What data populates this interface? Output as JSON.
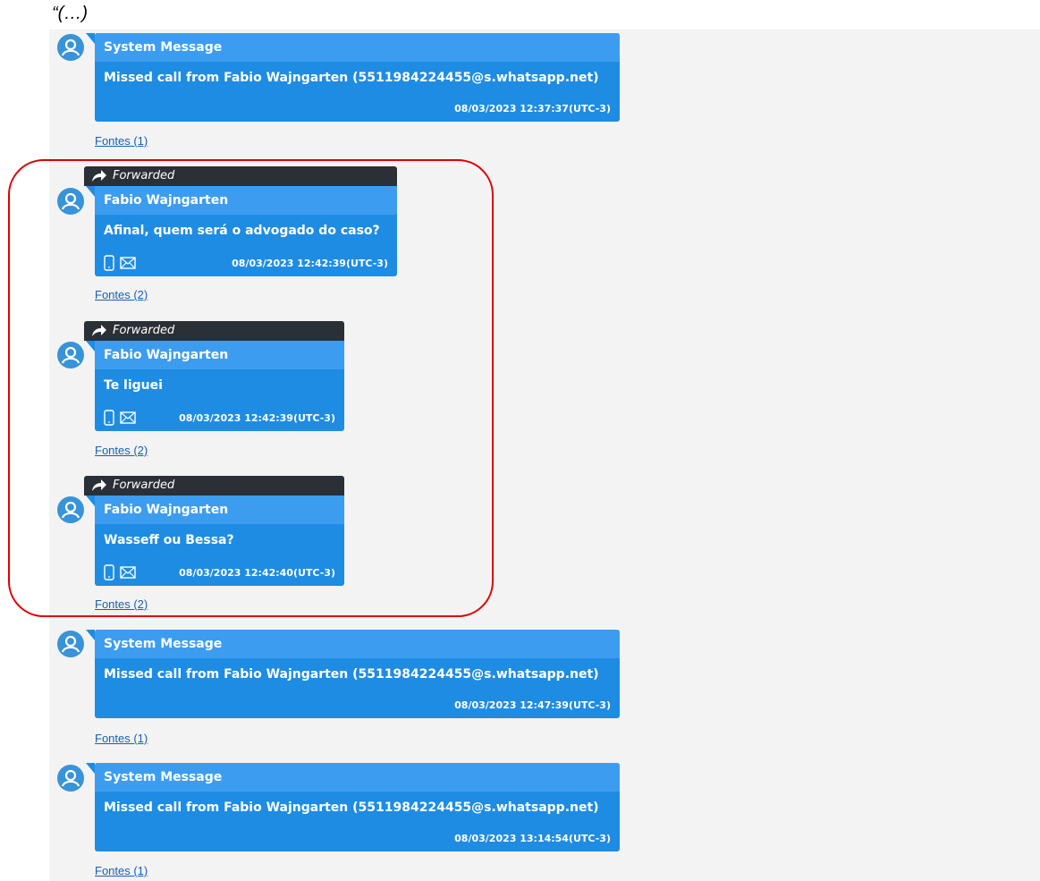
{
  "header": {
    "quote": "“(…)"
  },
  "colors": {
    "bubble": "#1e8ce3",
    "forward_bar": "#2b2f36",
    "highlight": "#e00000",
    "link": "#1a5fb4"
  },
  "messages": [
    {
      "type": "system",
      "sender": "System Message",
      "body": "Missed call from Fabio  Wajngarten (5511984224455@s.whatsapp.net)",
      "time": "08/03/2023 12:37:37(UTC-3)",
      "sources": "Fontes (1)"
    },
    {
      "type": "forwarded",
      "forward_label": "Forwarded",
      "sender": "Fabio  Wajngarten",
      "body": "Afinal, quem será o advogado do caso?",
      "time": "08/03/2023 12:42:39(UTC-3)",
      "icons": [
        "phone-icon",
        "envelope-icon"
      ],
      "sources": "Fontes (2)"
    },
    {
      "type": "forwarded",
      "forward_label": "Forwarded",
      "sender": "Fabio  Wajngarten",
      "body": "Te liguei",
      "time": "08/03/2023 12:42:39(UTC-3)",
      "icons": [
        "phone-icon",
        "envelope-icon"
      ],
      "sources": "Fontes (2)"
    },
    {
      "type": "forwarded",
      "forward_label": "Forwarded",
      "sender": "Fabio  Wajngarten",
      "body": "Wasseff ou Bessa?",
      "time": "08/03/2023 12:42:40(UTC-3)",
      "icons": [
        "phone-icon",
        "envelope-icon"
      ],
      "sources": "Fontes (2)"
    },
    {
      "type": "system",
      "sender": "System Message",
      "body": "Missed call from Fabio  Wajngarten (5511984224455@s.whatsapp.net)",
      "time": "08/03/2023 12:47:39(UTC-3)",
      "sources": "Fontes (1)"
    },
    {
      "type": "system",
      "sender": "System Message",
      "body": "Missed call from Fabio  Wajngarten (5511984224455@s.whatsapp.net)",
      "time": "08/03/2023 13:14:54(UTC-3)",
      "sources": "Fontes (1)"
    }
  ]
}
